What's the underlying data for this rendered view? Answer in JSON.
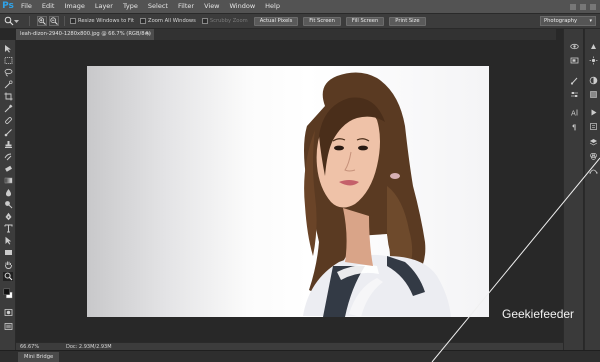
{
  "app": {
    "logo": "Ps"
  },
  "menu": [
    "File",
    "Edit",
    "Image",
    "Layer",
    "Type",
    "Select",
    "Filter",
    "View",
    "Window",
    "Help"
  ],
  "options": {
    "resize_windows": "Resize Windows to Fit",
    "zoom_all": "Zoom All Windows",
    "scrubby": "Scrubby Zoom",
    "actual_pixels": "Actual Pixels",
    "fit_screen": "Fit Screen",
    "fill_screen": "Fill Screen",
    "print_size": "Print Size"
  },
  "workspace": "Photography",
  "document": {
    "tab": "leah-dizon-2940-1280x800.jpg @ 66.7% (RGB/8#)",
    "close": "×"
  },
  "status": {
    "zoom": "66.67%",
    "doc": "Doc: 2.93M/2.93M"
  },
  "bridge": {
    "tab": "Mini Bridge"
  },
  "watermark": "Geekiefeeder",
  "colors": {
    "accent": "#2fa3e9",
    "panel": "#3c3c3c",
    "menubar": "#535353",
    "canvas": "#282828"
  }
}
